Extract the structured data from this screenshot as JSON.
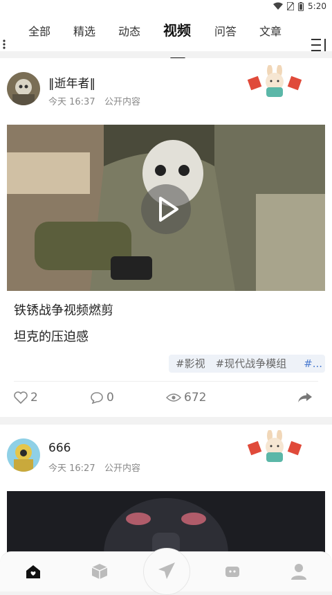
{
  "status": {
    "time": "5:20"
  },
  "tabs": [
    {
      "label": "全部"
    },
    {
      "label": "精选"
    },
    {
      "label": "动态"
    },
    {
      "label": "视频"
    },
    {
      "label": "问答"
    },
    {
      "label": "文章"
    }
  ],
  "active_tab": "视频",
  "posts": [
    {
      "username": "‖逝年者‖",
      "time": "今天 16:37",
      "visibility": "公开内容",
      "title": "铁锈战争视频燃剪",
      "subtitle": "坦克的压迫感",
      "tags": [
        "#影视",
        "#现代战争模组"
      ],
      "tag_more": "#...",
      "likes": "2",
      "comments": "0",
      "views": "672"
    },
    {
      "username": "666",
      "time": "今天 16:27",
      "visibility": "公开内容"
    }
  ],
  "icons": {
    "like": "heart-outline-icon",
    "comment": "speech-bubble-icon",
    "views": "eye-icon",
    "share": "share-arrow-icon"
  },
  "bottom_nav": [
    "home-icon",
    "box-icon",
    "paper-plane-icon",
    "chat-icon",
    "user-icon"
  ],
  "colors": {
    "accent": "#111111",
    "tag_bg": "#eef2f8",
    "tag_more": "#4a7bd0"
  }
}
